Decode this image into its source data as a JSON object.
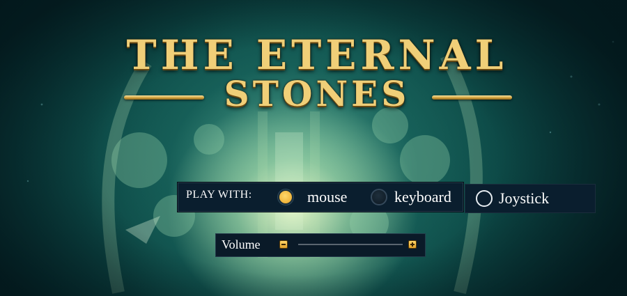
{
  "title": {
    "line1": "THE ETERNAL",
    "line2": "STONES"
  },
  "settings": {
    "play_with_label": "PLAY WITH:",
    "options": [
      {
        "label": "mouse",
        "selected": true
      },
      {
        "label": "keyboard",
        "selected": false
      },
      {
        "label": "Joystick",
        "selected": false
      }
    ]
  },
  "volume": {
    "label": "Volume",
    "level": 0.0
  },
  "colors": {
    "accent_gold": "#f0b43a",
    "panel_bg": "#0a1e2e",
    "title_gold": "#f0cf78"
  }
}
